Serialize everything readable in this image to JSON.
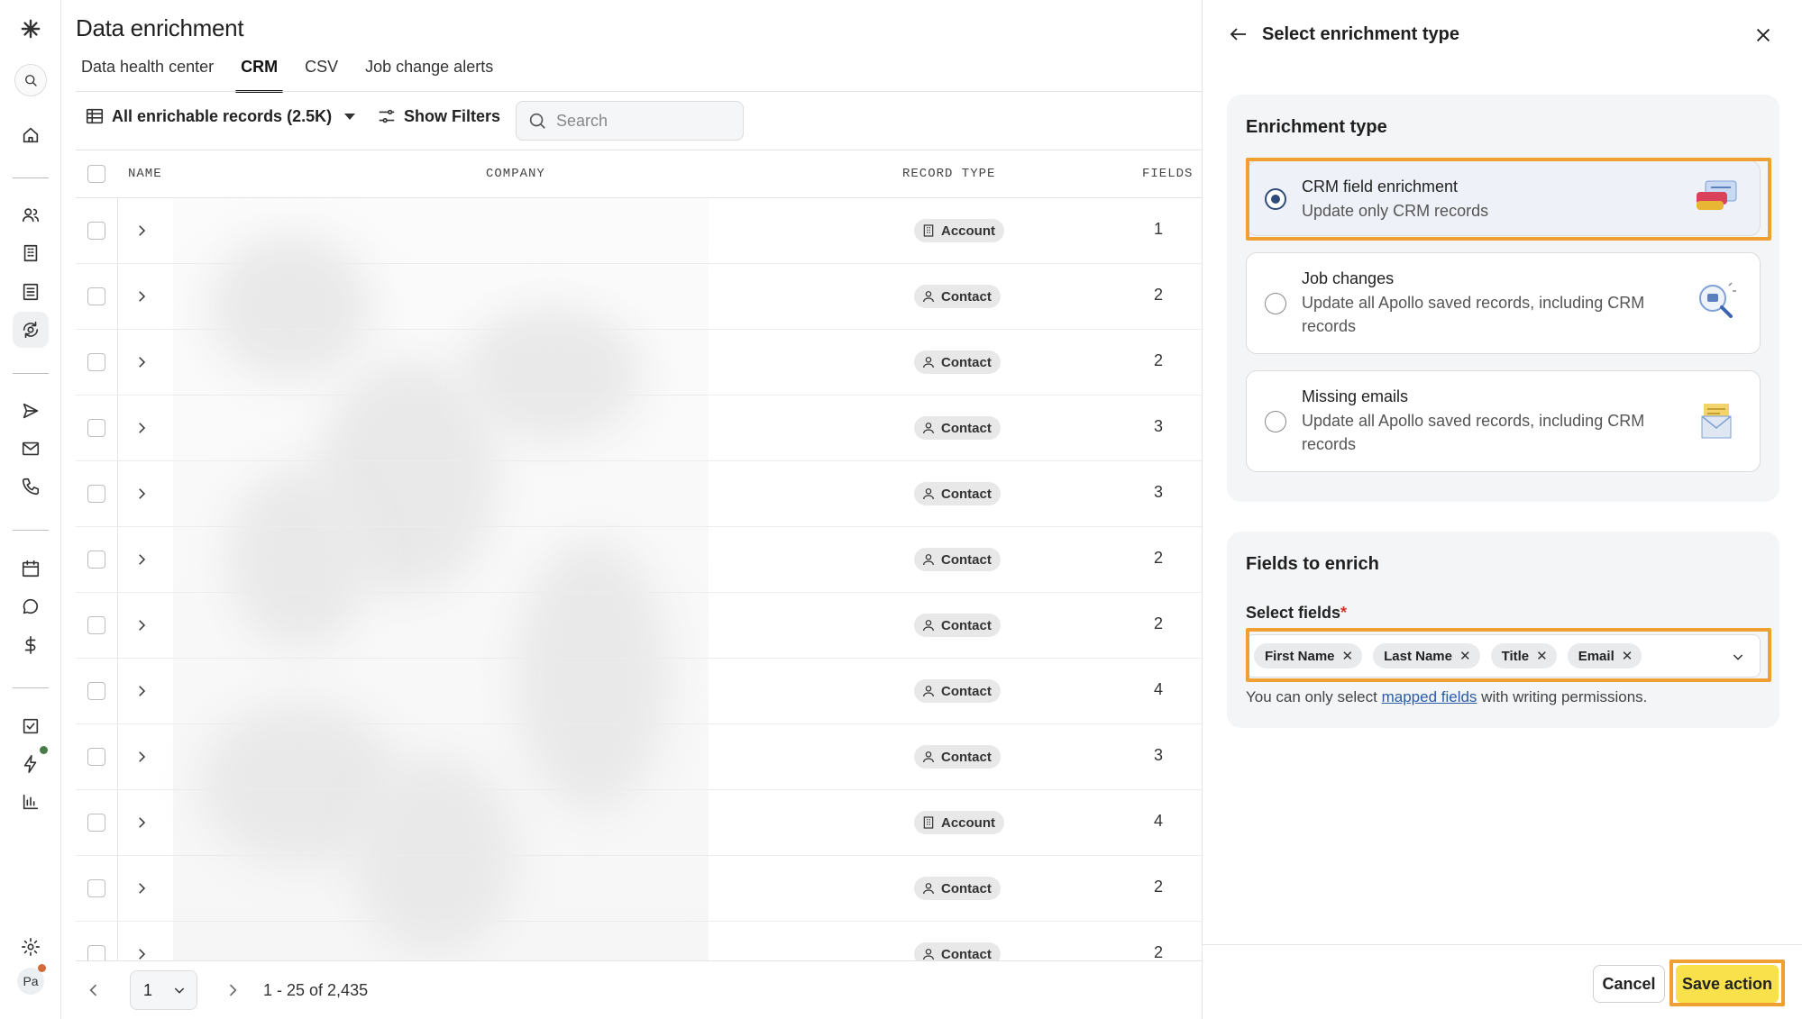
{
  "app": {
    "page_title": "Data enrichment",
    "tabs": [
      {
        "label": "Data health center",
        "active": false
      },
      {
        "label": "CRM",
        "active": true
      },
      {
        "label": "CSV",
        "active": false
      },
      {
        "label": "Job change alerts",
        "active": false
      }
    ]
  },
  "toolbar": {
    "view_label": "All enrichable records (2.5K)",
    "filters_label": "Show Filters",
    "search_placeholder": "Search"
  },
  "table": {
    "columns": [
      "NAME",
      "COMPANY",
      "RECORD TYPE",
      "FIELDS"
    ],
    "rows": [
      {
        "record_type": "Account",
        "fields": "1"
      },
      {
        "record_type": "Contact",
        "fields": "2"
      },
      {
        "record_type": "Contact",
        "fields": "2"
      },
      {
        "record_type": "Contact",
        "fields": "3"
      },
      {
        "record_type": "Contact",
        "fields": "3"
      },
      {
        "record_type": "Contact",
        "fields": "2"
      },
      {
        "record_type": "Contact",
        "fields": "2"
      },
      {
        "record_type": "Contact",
        "fields": "4"
      },
      {
        "record_type": "Contact",
        "fields": "3"
      },
      {
        "record_type": "Account",
        "fields": "4"
      },
      {
        "record_type": "Contact",
        "fields": "2"
      },
      {
        "record_type": "Contact",
        "fields": "2"
      }
    ]
  },
  "pager": {
    "page": "1",
    "range": "1 - 25 of 2,435"
  },
  "panel": {
    "title": "Select enrichment type",
    "enrichment_card_title": "Enrichment type",
    "options": [
      {
        "title": "CRM field enrichment",
        "desc": "Update only CRM records",
        "selected": true
      },
      {
        "title": "Job changes",
        "desc": "Update all Apollo saved records, including CRM records",
        "selected": false
      },
      {
        "title": "Missing emails",
        "desc": "Update all Apollo saved records, including CRM records",
        "selected": false
      }
    ],
    "fields_card_title": "Fields to enrich",
    "select_fields_label": "Select fields",
    "required_mark": "*",
    "chips": [
      "First Name",
      "Last Name",
      "Title",
      "Email"
    ],
    "hint_prefix": "You can only select ",
    "hint_link": "mapped fields",
    "hint_suffix": " with writing permissions.",
    "cancel_label": "Cancel",
    "save_label": "Save action"
  },
  "user": {
    "initials": "Pa"
  },
  "colors": {
    "highlight": "#f0a033",
    "save_button": "#f8e14a",
    "radio_selected": "#2e4b7a",
    "link": "#2b5ba8"
  }
}
